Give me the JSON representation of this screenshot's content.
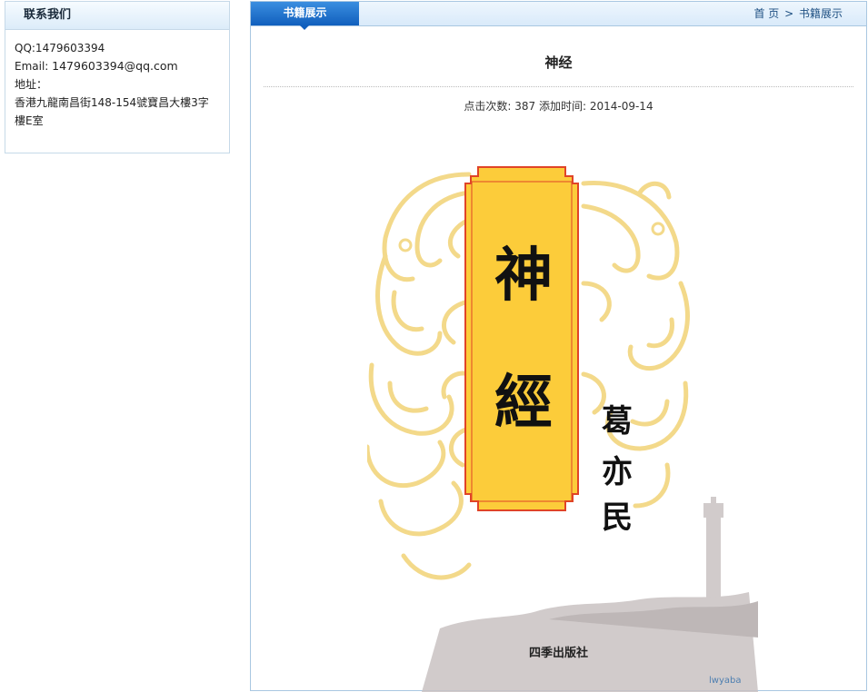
{
  "contact": {
    "header": "联系我们",
    "qq": "QQ:1479603394",
    "email_label": "Email: ",
    "email_value": "1479603394@qq.com",
    "address_label": "地址：",
    "address_line1": "香港九龍南昌街148-154號寶昌大樓3字",
    "address_line2": "樓E室"
  },
  "main": {
    "tab_label": "书籍展示",
    "breadcrumb": {
      "home": "首 页",
      "separator": ">",
      "current": "书籍展示"
    },
    "book_title": "神经",
    "meta": "点击次数: 387 添加时间: 2014-09-14"
  },
  "cover": {
    "title_char_1": "神",
    "title_char_2": "經",
    "author_1": "葛",
    "author_2": "亦",
    "author_3": "民",
    "publisher": "四季出版社",
    "watermark": "lwyaba"
  },
  "colors": {
    "tab_blue": "#115fbd",
    "banner_yellow": "#fccc3a",
    "banner_border": "#e04427",
    "cloud_yellow": "#f3d98a"
  }
}
